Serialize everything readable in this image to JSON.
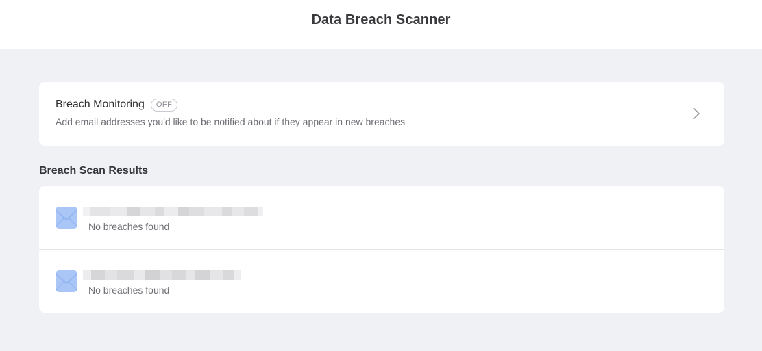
{
  "header": {
    "title": "Data Breach Scanner"
  },
  "monitoring": {
    "title": "Breach Monitoring",
    "badge": "OFF",
    "subtitle": "Add email addresses you'd like to be notified about if they appear in new breaches",
    "chevron_icon": "chevron-right-icon"
  },
  "results": {
    "title": "Breach Scan Results",
    "items": [
      {
        "icon": "envelope-icon",
        "email_redacted": true,
        "status": "No breaches found"
      },
      {
        "icon": "envelope-icon",
        "email_redacted": true,
        "status": "No breaches found"
      }
    ]
  },
  "colors": {
    "background": "#f0f1f5",
    "card": "#ffffff",
    "mail_icon": "#a9c6f7",
    "text_secondary": "#707177"
  }
}
